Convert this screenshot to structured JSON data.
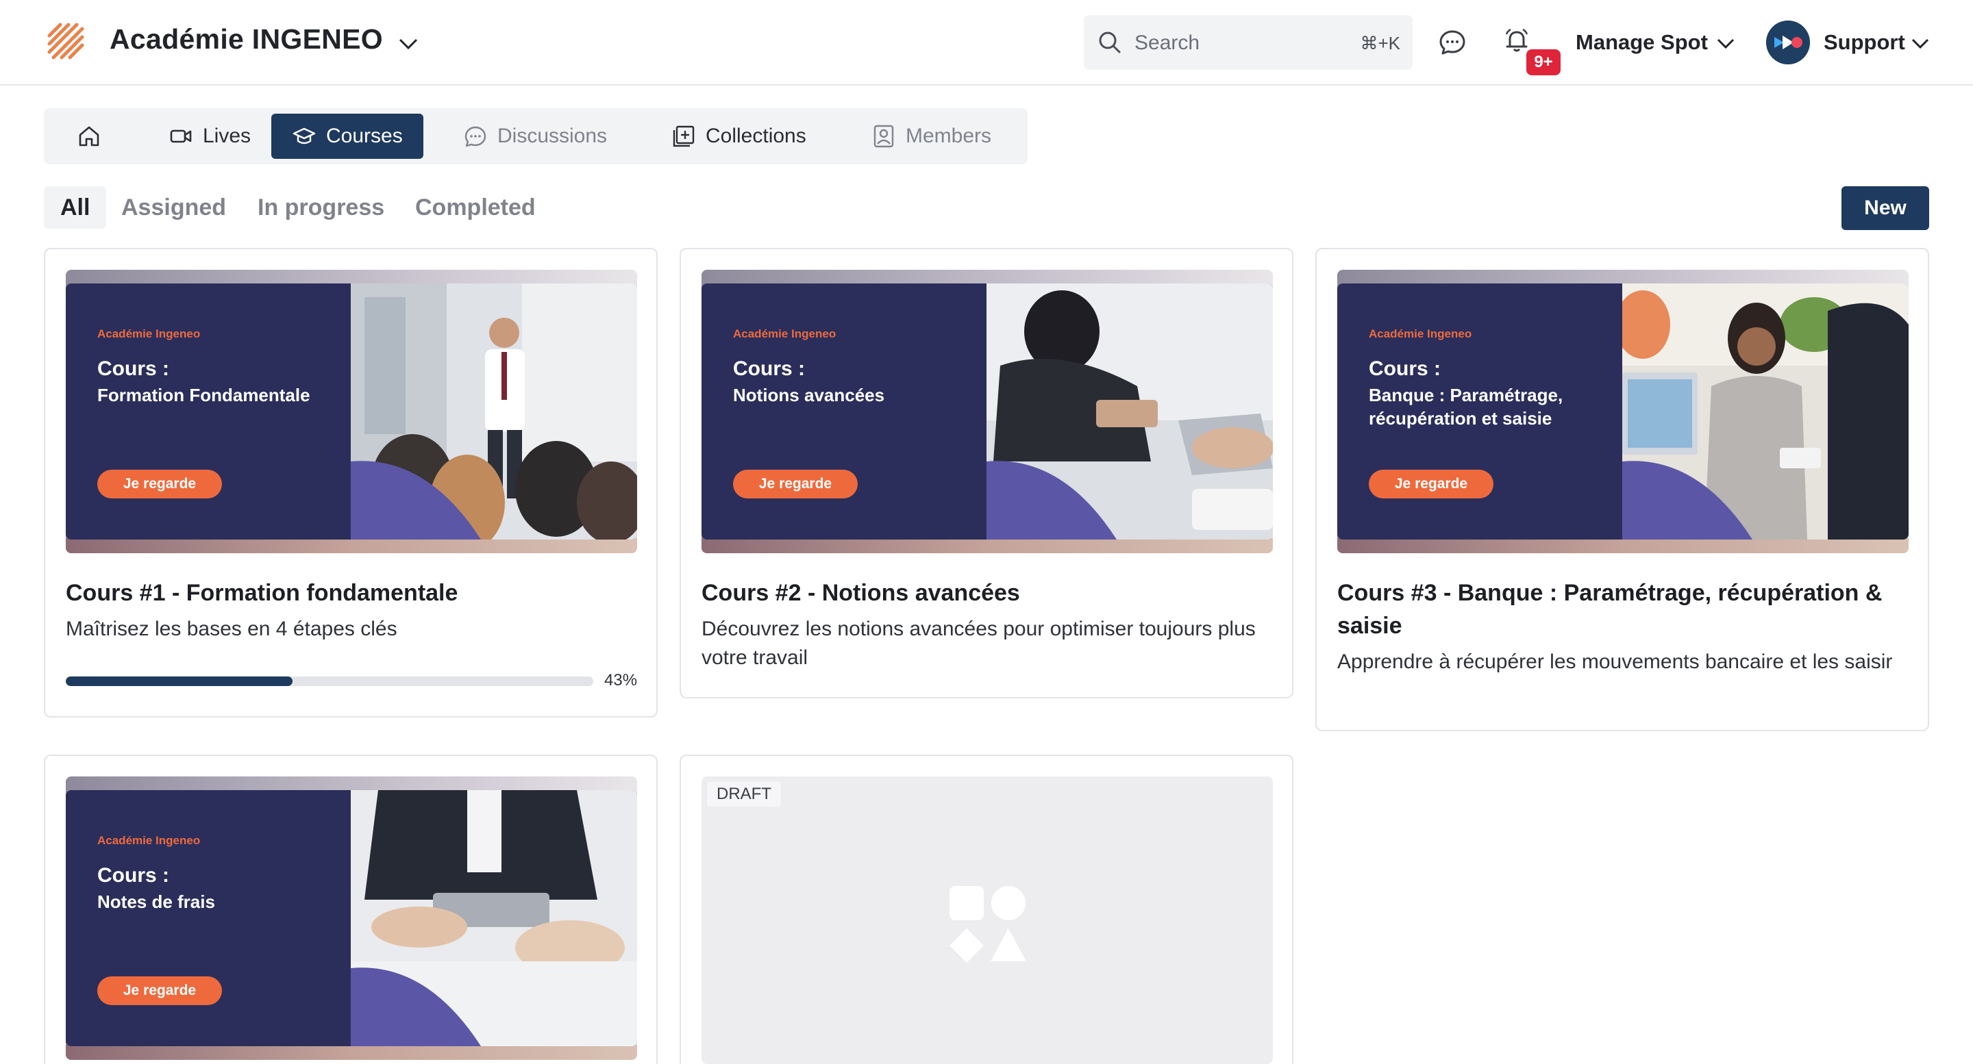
{
  "header": {
    "brand": "Académie INGENEO",
    "search_placeholder": "Search",
    "search_shortcut": "⌘+K",
    "notification_count": "9+",
    "space_label": "Manage Spot",
    "user_label": "Support"
  },
  "tabs": [
    {
      "label": "",
      "icon": "home-icon"
    },
    {
      "label": "Lives",
      "icon": "video-icon"
    },
    {
      "label": "Courses",
      "icon": "graduation-cap-icon",
      "active": true
    },
    {
      "label": "Discussions",
      "icon": "chat-icon"
    },
    {
      "label": "Collections",
      "icon": "collection-icon"
    },
    {
      "label": "Members",
      "icon": "member-icon"
    }
  ],
  "filters": [
    "All",
    "Assigned",
    "In progress",
    "Completed"
  ],
  "active_filter": "All",
  "new_button": "New",
  "banner_common": {
    "brandline": "Académie Ingeneo",
    "heading": "Cours :",
    "cta": "Je regarde"
  },
  "courses": [
    {
      "banner_subtitle": "Formation Fondamentale",
      "title": "Cours #1 - Formation fondamentale",
      "description": "Maîtrisez les bases en 4 étapes clés",
      "progress_percent": 43,
      "progress_label": "43%"
    },
    {
      "banner_subtitle": "Notions avancées",
      "title": "Cours #2 - Notions avancées",
      "description": "Découvrez les notions avancées pour optimiser toujours plus votre travail"
    },
    {
      "banner_subtitle": "Banque : Paramétrage, récupération et saisie",
      "title": "Cours #3 - Banque : Paramétrage, récupération & saisie",
      "description": "Apprendre à récupérer les mouvements bancaire et les saisir"
    },
    {
      "banner_subtitle": "Notes de frais"
    }
  ],
  "draft_card": {
    "label": "DRAFT"
  },
  "colors": {
    "primary": "#1f3a5f",
    "banner": "#2b2e5a",
    "accent": "#ee6a3d",
    "badge": "#e0243a"
  }
}
